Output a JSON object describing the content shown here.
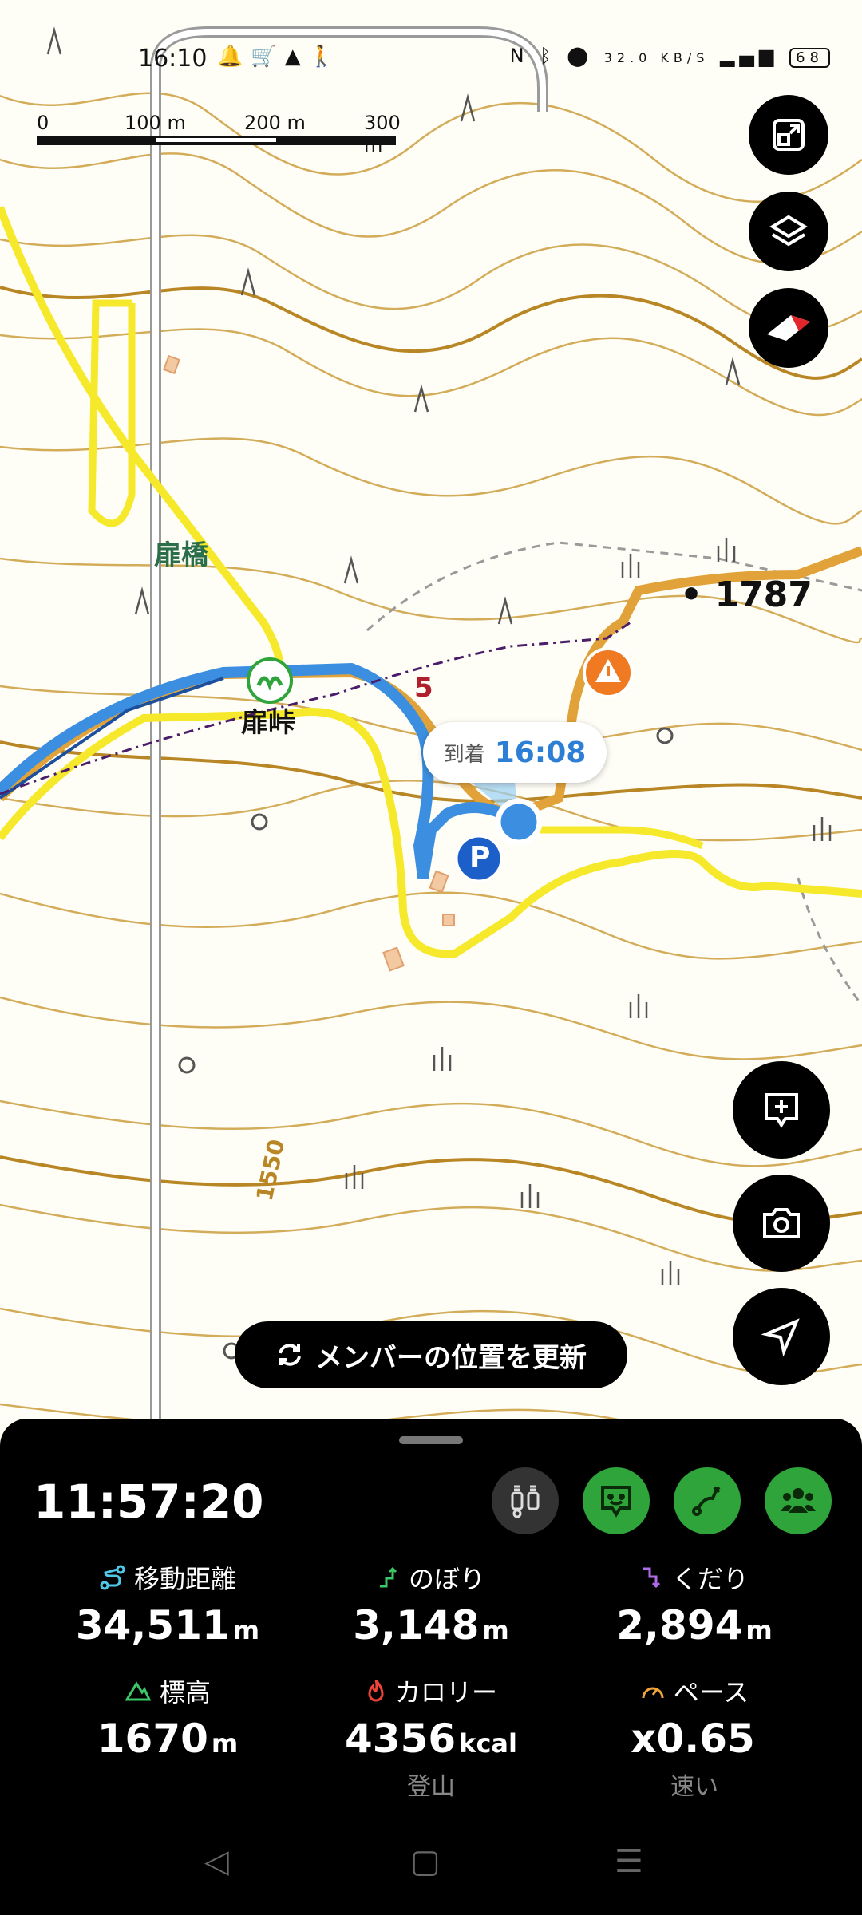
{
  "status_bar": {
    "time": "16:10",
    "left_icons": [
      "bell-icon",
      "cart-icon",
      "warning-icon",
      "person-icon"
    ],
    "network_speed": "32.0 KB/S",
    "battery": "68"
  },
  "scale_bar": {
    "labels": [
      "0",
      "100 m",
      "200 m",
      "300 m"
    ]
  },
  "map": {
    "place_labels": [
      "扉橋",
      "扉峠"
    ],
    "contour_label": "1550",
    "peak_elevation": "1787",
    "route_number": "5",
    "eta": {
      "label": "到着",
      "time": "16:08"
    },
    "parking": "P"
  },
  "fab_buttons": [
    "fullscreen-exit-icon",
    "layers-icon",
    "compass-icon",
    "add-memo-icon",
    "camera-icon",
    "navigation-icon"
  ],
  "update_members_label": "メンバーの位置を更新",
  "panel": {
    "elapsed_time": "11:57:20",
    "tools": [
      "sensor-icon",
      "assistant-icon",
      "route-icon",
      "group-icon"
    ],
    "stats": {
      "distance": {
        "label": "移動距離",
        "value": "34,511",
        "unit": "m"
      },
      "ascent": {
        "label": "のぼり",
        "value": "3,148",
        "unit": "m"
      },
      "descent": {
        "label": "くだり",
        "value": "2,894",
        "unit": "m"
      },
      "altitude": {
        "label": "標高",
        "value": "1670",
        "unit": "m"
      },
      "calories": {
        "label": "カロリー",
        "value": "4356",
        "unit": "kcal",
        "sub": "登山"
      },
      "pace": {
        "label": "ペース",
        "value": "x0.65",
        "unit": "",
        "sub": "速い"
      }
    }
  },
  "colors": {
    "accent_green": "#2ea43a",
    "route_blue": "#3c8fe0",
    "road_yellow": "#f6e82a",
    "contour": "#c8a046"
  }
}
